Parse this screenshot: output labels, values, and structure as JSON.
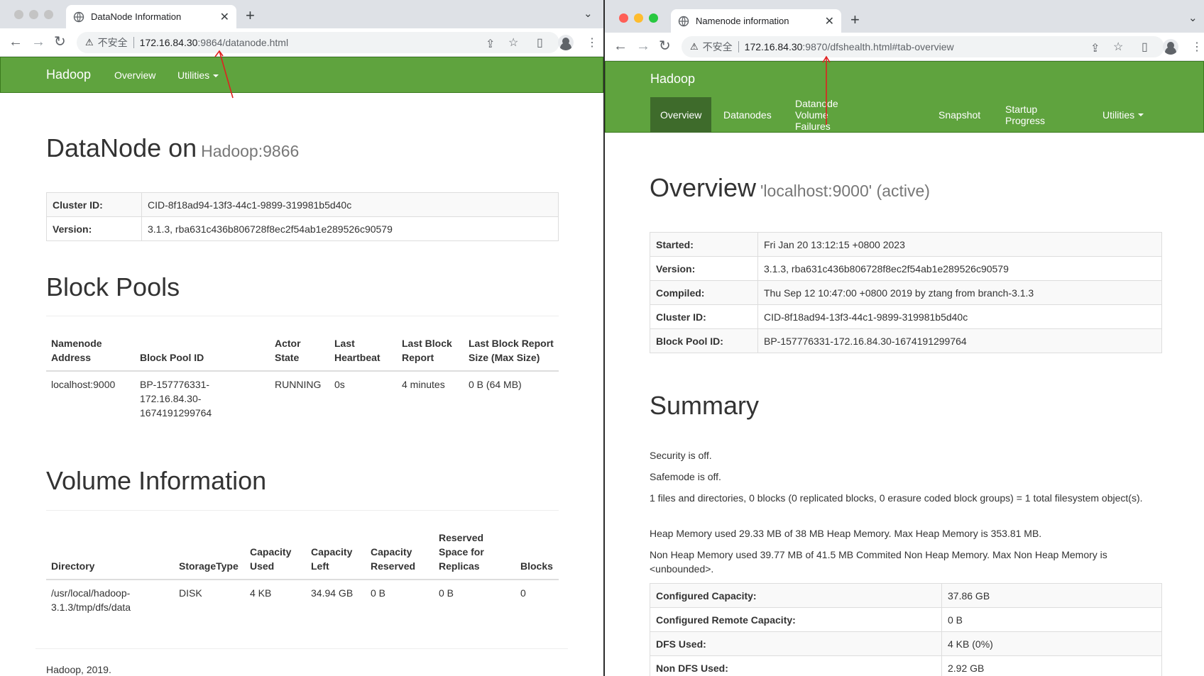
{
  "left_window": {
    "tab_title": "DataNode Information",
    "url_insecure": "不安全",
    "url_host": "172.16.84.30",
    "url_path": ":9864/datanode.html",
    "nav": {
      "brand": "Hadoop",
      "overview": "Overview",
      "utilities": "Utilities"
    },
    "heading": "DataNode on",
    "heading_small": "Hadoop:9866",
    "info": [
      {
        "key": "Cluster ID:",
        "value": "CID-8f18ad94-13f3-44c1-9899-319981b5d40c"
      },
      {
        "key": "Version:",
        "value": "3.1.3, rba631c436b806728f8ec2f54ab1e289526c90579"
      }
    ],
    "block_pools": {
      "title": "Block Pools",
      "headers": [
        "Namenode Address",
        "Block Pool ID",
        "Actor State",
        "Last Heartbeat",
        "Last Block Report",
        "Last Block Report Size (Max Size)"
      ],
      "rows": [
        [
          "localhost:9000",
          "BP-157776331-172.16.84.30-1674191299764",
          "RUNNING",
          "0s",
          "4 minutes",
          "0 B (64 MB)"
        ]
      ]
    },
    "volume_info": {
      "title": "Volume Information",
      "headers": [
        "Directory",
        "StorageType",
        "Capacity Used",
        "Capacity Left",
        "Capacity Reserved",
        "Reserved Space for Replicas",
        "Blocks"
      ],
      "rows": [
        [
          "/usr/local/hadoop-3.1.3/tmp/dfs/data",
          "DISK",
          "4 KB",
          "34.94 GB",
          "0 B",
          "0 B",
          "0"
        ]
      ]
    },
    "footer": "Hadoop, 2019."
  },
  "right_window": {
    "tab_title": "Namenode information",
    "url_insecure": "不安全",
    "url_host": "172.16.84.30",
    "url_path": ":9870/dfshealth.html#tab-overview",
    "nav": {
      "brand": "Hadoop",
      "tabs": [
        "Overview",
        "Datanodes",
        "Datanode Volume Failures",
        "Snapshot",
        "Startup Progress",
        "Utilities"
      ],
      "active_tab": "Overview"
    },
    "heading": "Overview",
    "heading_small": "'localhost:9000' (active)",
    "info": [
      {
        "key": "Started:",
        "value": "Fri Jan 20 13:12:15 +0800 2023"
      },
      {
        "key": "Version:",
        "value": "3.1.3, rba631c436b806728f8ec2f54ab1e289526c90579"
      },
      {
        "key": "Compiled:",
        "value": "Thu Sep 12 10:47:00 +0800 2019 by ztang from branch-3.1.3"
      },
      {
        "key": "Cluster ID:",
        "value": "CID-8f18ad94-13f3-44c1-9899-319981b5d40c"
      },
      {
        "key": "Block Pool ID:",
        "value": "BP-157776331-172.16.84.30-1674191299764"
      }
    ],
    "summary": {
      "title": "Summary",
      "lines": [
        "Security is off.",
        "Safemode is off.",
        "1 files and directories, 0 blocks (0 replicated blocks, 0 erasure coded block groups) = 1 total filesystem object(s).",
        "Heap Memory used 29.33 MB of 38 MB Heap Memory. Max Heap Memory is 353.81 MB.",
        "Non Heap Memory used 39.77 MB of 41.5 MB Commited Non Heap Memory. Max Non Heap Memory is <unbounded>."
      ],
      "capacity": [
        {
          "key": "Configured Capacity:",
          "value": "37.86 GB"
        },
        {
          "key": "Configured Remote Capacity:",
          "value": "0 B"
        },
        {
          "key": "DFS Used:",
          "value": "4 KB (0%)"
        },
        {
          "key": "Non DFS Used:",
          "value": "2.92 GB"
        }
      ]
    }
  },
  "colors": {
    "navbar": "#5fa33e",
    "navbar_active": "#3e6b2b",
    "annotation_arrow": "#e02020"
  }
}
